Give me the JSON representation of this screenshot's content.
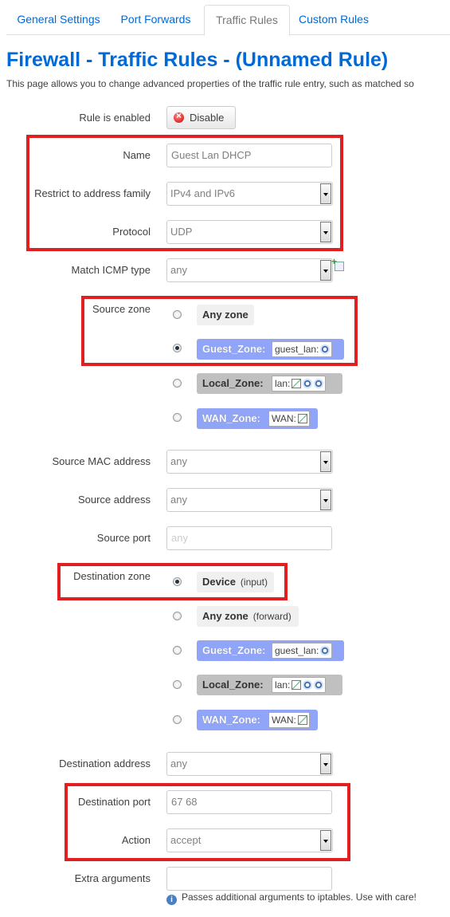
{
  "tabs": [
    "General Settings",
    "Port Forwards",
    "Traffic Rules",
    "Custom Rules"
  ],
  "page_title": "Firewall - Traffic Rules - (Unnamed Rule)",
  "description": "This page allows you to change advanced properties of the traffic rule entry, such as matched so",
  "form": {
    "enabled_label": "Rule is enabled",
    "disable_button": "Disable",
    "name_label": "Name",
    "name_placeholder": "Guest Lan DHCP",
    "family_label": "Restrict to address family",
    "family_value": "IPv4 and IPv6",
    "protocol_label": "Protocol",
    "protocol_value": "UDP",
    "icmp_label": "Match ICMP type",
    "icmp_value": "any",
    "source_zone_label": "Source zone",
    "src_zones": {
      "any": "Any zone",
      "guest": "Guest_Zone:",
      "guest_nets": "guest_lan:",
      "local": "Local_Zone:",
      "local_nets": "lan:",
      "wan": "WAN_Zone:",
      "wan_nets": "WAN:"
    },
    "source_mac_label": "Source MAC address",
    "source_mac_value": "any",
    "source_addr_label": "Source address",
    "source_addr_value": "any",
    "source_port_label": "Source port",
    "source_port_placeholder": "any",
    "dest_zone_label": "Destination zone",
    "dest_zones": {
      "device": "Device",
      "device_sub": "(input)",
      "any": "Any zone",
      "any_sub": "(forward)",
      "guest": "Guest_Zone:",
      "guest_nets": "guest_lan:",
      "local": "Local_Zone:",
      "local_nets": "lan:",
      "wan": "WAN_Zone:",
      "wan_nets": "WAN:"
    },
    "dest_addr_label": "Destination address",
    "dest_addr_value": "any",
    "dest_port_label": "Destination port",
    "dest_port_value": "67 68",
    "action_label": "Action",
    "action_value": "accept",
    "extra_label": "Extra arguments",
    "extra_value": "",
    "extra_hint": "Passes additional arguments to iptables. Use with care!"
  },
  "colors": {
    "link_blue": "#0069d6",
    "zone_blue": "#90a4f8",
    "zone_grey": "#c0c0c0",
    "highlight_red": "#e02020"
  }
}
